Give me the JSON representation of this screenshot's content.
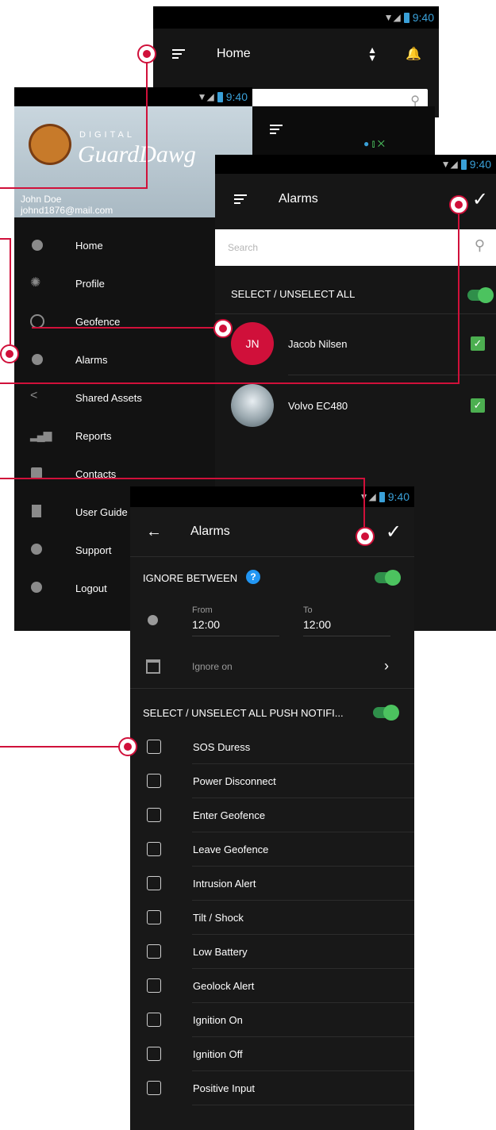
{
  "home_screen": {
    "status_time": "9:40",
    "title": "Home",
    "search_placeholder": ""
  },
  "drawer_screen": {
    "status_time": "9:40",
    "brand_top": "DIGITAL",
    "brand_main": "GuardDawg",
    "user_name": "John Doe",
    "user_email": "johnd1876@mail.com",
    "menu": [
      {
        "label": "Home",
        "icon": "home-icon"
      },
      {
        "label": "Profile",
        "icon": "gear-icon"
      },
      {
        "label": "Geofence",
        "icon": "geofence-icon"
      },
      {
        "label": "Alarms",
        "icon": "alarm-icon"
      },
      {
        "label": "Shared Assets",
        "icon": "share-icon"
      },
      {
        "label": "Reports",
        "icon": "bar-chart-icon"
      },
      {
        "label": "Contacts",
        "icon": "contact-icon"
      },
      {
        "label": "User Guide",
        "icon": "document-icon"
      },
      {
        "label": "Support",
        "icon": "info-icon"
      },
      {
        "label": "Logout",
        "icon": "power-icon"
      }
    ]
  },
  "alarms_list_screen": {
    "status_time": "9:40",
    "title": "Alarms",
    "search_placeholder": "Search",
    "select_all_label": "SELECT / UNSELECT ALL",
    "items": [
      {
        "initials": "JN",
        "name": "Jacob Nilsen",
        "checked": true
      },
      {
        "initials": "",
        "name": "Volvo EC480",
        "checked": true
      }
    ]
  },
  "alarm_settings_screen": {
    "status_time": "9:40",
    "title": "Alarms",
    "ignore_between_label": "IGNORE BETWEEN",
    "help_glyph": "?",
    "from_label": "From",
    "from_value": "12:00",
    "to_label": "To",
    "to_value": "12:00",
    "ignore_on_label": "Ignore on",
    "select_all_push_label": "SELECT / UNSELECT ALL PUSH NOTIFI...",
    "notifications": [
      "SOS Duress",
      "Power Disconnect",
      "Enter Geofence",
      "Leave Geofence",
      "Intrusion Alert",
      "Tilt / Shock",
      "Low Battery",
      "Geolock Alert",
      "Ignition On",
      "Ignition Off",
      "Positive Input"
    ]
  },
  "colors": {
    "accent": "#d0103a",
    "toggle_on": "#4cc35f",
    "status_blue": "#3aa0d8",
    "check_green": "#4caf50"
  }
}
